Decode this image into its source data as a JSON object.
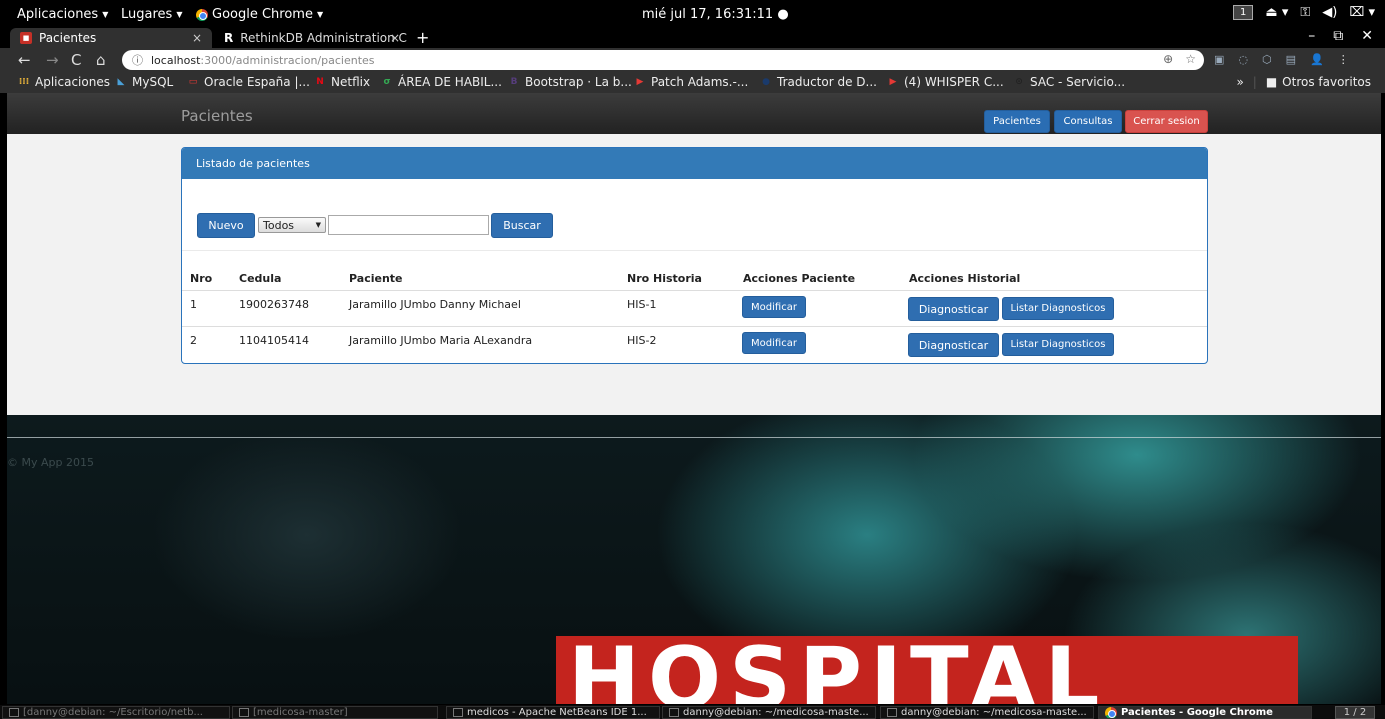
{
  "system_bar": {
    "apps_menu": "Aplicaciones",
    "places_menu": "Lugares",
    "app_name": "Google Chrome",
    "clock": "mié jul 17, 16:31:11",
    "workspace": "1"
  },
  "tabs": [
    {
      "title": "Pacientes"
    },
    {
      "title": "RethinkDB Administration C"
    }
  ],
  "address_bar": {
    "host": "localhost",
    "path": ":3000/administracion/pacientes"
  },
  "bookmarks": [
    {
      "label": "Aplicaciones",
      "color": "#e8b33a",
      "glyph": "⁞⁞⁞"
    },
    {
      "label": "MySQL",
      "color": "#4aa0d8",
      "glyph": "◣"
    },
    {
      "label": "Oracle España |...",
      "color": "#e53935",
      "glyph": "▭"
    },
    {
      "label": "Netflix",
      "color": "#e50914",
      "glyph": "N"
    },
    {
      "label": "ÁREA DE HABIL...",
      "color": "#34a853",
      "glyph": "σ"
    },
    {
      "label": "Bootstrap · La b...",
      "color": "#563d7c",
      "glyph": "B"
    },
    {
      "label": "Patch Adams.-...",
      "color": "#e53935",
      "glyph": "▶"
    },
    {
      "label": "Traductor de D...",
      "color": "#1a3a6b",
      "glyph": "●"
    },
    {
      "label": "(4) WHISPER C...",
      "color": "#e53935",
      "glyph": "▶"
    },
    {
      "label": "SAC - Servicio...",
      "color": "#222222",
      "glyph": "⊙"
    }
  ],
  "other_bookmarks": "Otros favoritos",
  "app": {
    "brand": "Pacientes",
    "nav": {
      "pacientes": "Pacientes",
      "consultas": "Consultas",
      "logout": "Cerrar sesion"
    },
    "panel_title": "Listado de pacientes",
    "new_button": "Nuevo",
    "filter_value": "Todos",
    "search_value": "",
    "search_button": "Buscar",
    "table": {
      "headers": [
        "Nro",
        "Cedula",
        "Paciente",
        "Nro Historia",
        "Acciones Paciente",
        "Acciones Historial"
      ],
      "rows": [
        {
          "nro": "1",
          "cedula": "1900263748",
          "paciente": "Jaramillo JUmbo Danny Michael",
          "historia": "HIS-1"
        },
        {
          "nro": "2",
          "cedula": "1104105414",
          "paciente": "Jaramillo JUmbo Maria ALexandra",
          "historia": "HIS-2"
        }
      ],
      "modify_label": "Modificar",
      "diagnose_label": "Diagnosticar",
      "list_label": "Listar Diagnosticos"
    },
    "footer": "© My App 2015",
    "hero_text": "HOSPITAL"
  },
  "taskbar": {
    "items": [
      "[danny@debian: ~/Escritorio/netb...",
      "[medicosa-master]",
      "medicos - Apache NetBeans IDE 1...",
      "danny@debian: ~/medicosa-maste...",
      "danny@debian: ~/medicosa-maste...",
      "Pacientes - Google Chrome"
    ],
    "pager": "1 / 2"
  },
  "colors": {
    "primary": "#337ab7",
    "danger": "#d9534f",
    "hero_band": "#c4241e"
  }
}
